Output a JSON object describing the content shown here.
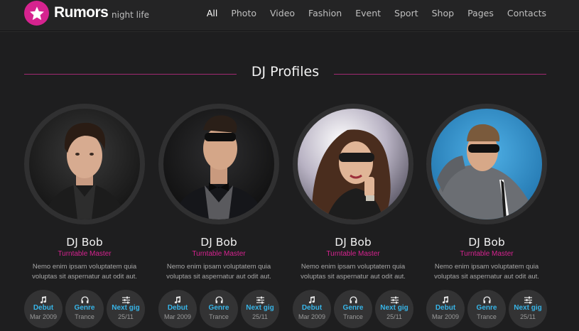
{
  "brand": {
    "title": "Rumors",
    "subtitle": "night life",
    "accent": "#d6238f"
  },
  "nav": {
    "items": [
      {
        "label": "All",
        "active": true
      },
      {
        "label": "Photo"
      },
      {
        "label": "Video"
      },
      {
        "label": "Fashion"
      },
      {
        "label": "Event"
      },
      {
        "label": "Sport"
      },
      {
        "label": "Shop"
      },
      {
        "label": "Pages"
      },
      {
        "label": "Contacts"
      }
    ]
  },
  "section": {
    "title": "DJ Profiles"
  },
  "profiles": [
    {
      "name": "DJ Bob",
      "role": "Turntable Master",
      "desc_line1": "Nemo enim ipsam voluptatem quia",
      "desc_line2": "voluptas sit aspernatur aut odit aut.",
      "stats": [
        {
          "icon": "music-note-icon",
          "label": "Debut",
          "value": "Mar 2009"
        },
        {
          "icon": "headphones-icon",
          "label": "Genre",
          "value": "Trance"
        },
        {
          "icon": "sliders-icon",
          "label": "Next gig",
          "value": "25/11"
        }
      ]
    },
    {
      "name": "DJ Bob",
      "role": "Turntable Master",
      "desc_line1": "Nemo enim ipsam voluptatem quia",
      "desc_line2": "voluptas sit aspernatur aut odit aut.",
      "stats": [
        {
          "icon": "music-note-icon",
          "label": "Debut",
          "value": "Mar 2009"
        },
        {
          "icon": "headphones-icon",
          "label": "Genre",
          "value": "Trance"
        },
        {
          "icon": "sliders-icon",
          "label": "Next gig",
          "value": "25/11"
        }
      ]
    },
    {
      "name": "DJ Bob",
      "role": "Turntable Master",
      "desc_line1": "Nemo enim ipsam voluptatem quia",
      "desc_line2": "voluptas sit aspernatur aut odit aut.",
      "stats": [
        {
          "icon": "music-note-icon",
          "label": "Debut",
          "value": "Mar 2009"
        },
        {
          "icon": "headphones-icon",
          "label": "Genre",
          "value": "Trance"
        },
        {
          "icon": "sliders-icon",
          "label": "Next gig",
          "value": "25/11"
        }
      ]
    },
    {
      "name": "DJ Bob",
      "role": "Turntable Master",
      "desc_line1": "Nemo enim ipsam voluptatem quia",
      "desc_line2": "voluptas sit aspernatur aut odit aut.",
      "stats": [
        {
          "icon": "music-note-icon",
          "label": "Debut",
          "value": "Mar 2009"
        },
        {
          "icon": "headphones-icon",
          "label": "Genre",
          "value": "Trance"
        },
        {
          "icon": "sliders-icon",
          "label": "Next gig",
          "value": "25/11"
        }
      ]
    }
  ]
}
